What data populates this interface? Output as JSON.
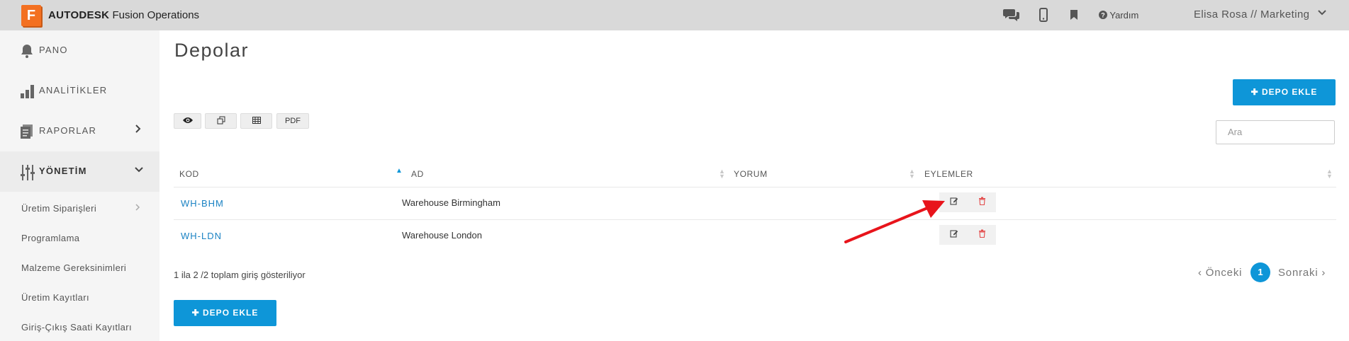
{
  "app": {
    "logo_letter": "F",
    "brand_bold": "AUTODESK",
    "brand_rest": "Fusion Operations",
    "help_label": "Yardım",
    "user_label": "Elisa Rosa // Marketing"
  },
  "icons": {
    "chat": "chat-icon",
    "mobile": "mobile-icon",
    "bookmark": "bookmark-icon",
    "help": "question-circle-icon",
    "user_menu": "chevron-down-icon"
  },
  "sidebar": {
    "items": [
      {
        "label": "PANO",
        "icon": "bell-icon"
      },
      {
        "label": "ANALİTİKLER",
        "icon": "bar-chart-icon"
      },
      {
        "label": "RAPORLAR",
        "icon": "document-icon"
      },
      {
        "label": "YÖNETİM",
        "icon": "sliders-icon"
      }
    ],
    "subitems": [
      "Üretim Siparişleri",
      "Programlama",
      "Malzeme Gereksinimleri",
      "Üretim Kayıtları",
      "Giriş-Çıkış Saati Kayıtları"
    ]
  },
  "page": {
    "title": "Depolar",
    "add_button": "DEPO EKLE",
    "search_placeholder": "Ara",
    "toolbar": {
      "view_icon": "eye-icon",
      "copy_icon": "copy-icon",
      "csv_icon": "table-icon",
      "pdf_label": "PDF"
    }
  },
  "table": {
    "headers": [
      "KOD",
      "AD",
      "YORUM",
      "EYLEMLER"
    ],
    "rows": [
      {
        "code": "WH-BHM",
        "name": "Warehouse Birmingham",
        "comment": ""
      },
      {
        "code": "WH-LDN",
        "name": "Warehouse London",
        "comment": ""
      }
    ],
    "info": "1 ila 2 /2 toplam giriş gösteriliyor"
  },
  "pagination": {
    "prev": "‹ Önceki",
    "current": "1",
    "next": "Sonraki ›"
  },
  "colors": {
    "accent": "#0e96d8",
    "logo": "#f37021",
    "topbar": "#d9d9d9",
    "delete": "#e34b4b",
    "annotation_arrow": "#e8141b"
  }
}
